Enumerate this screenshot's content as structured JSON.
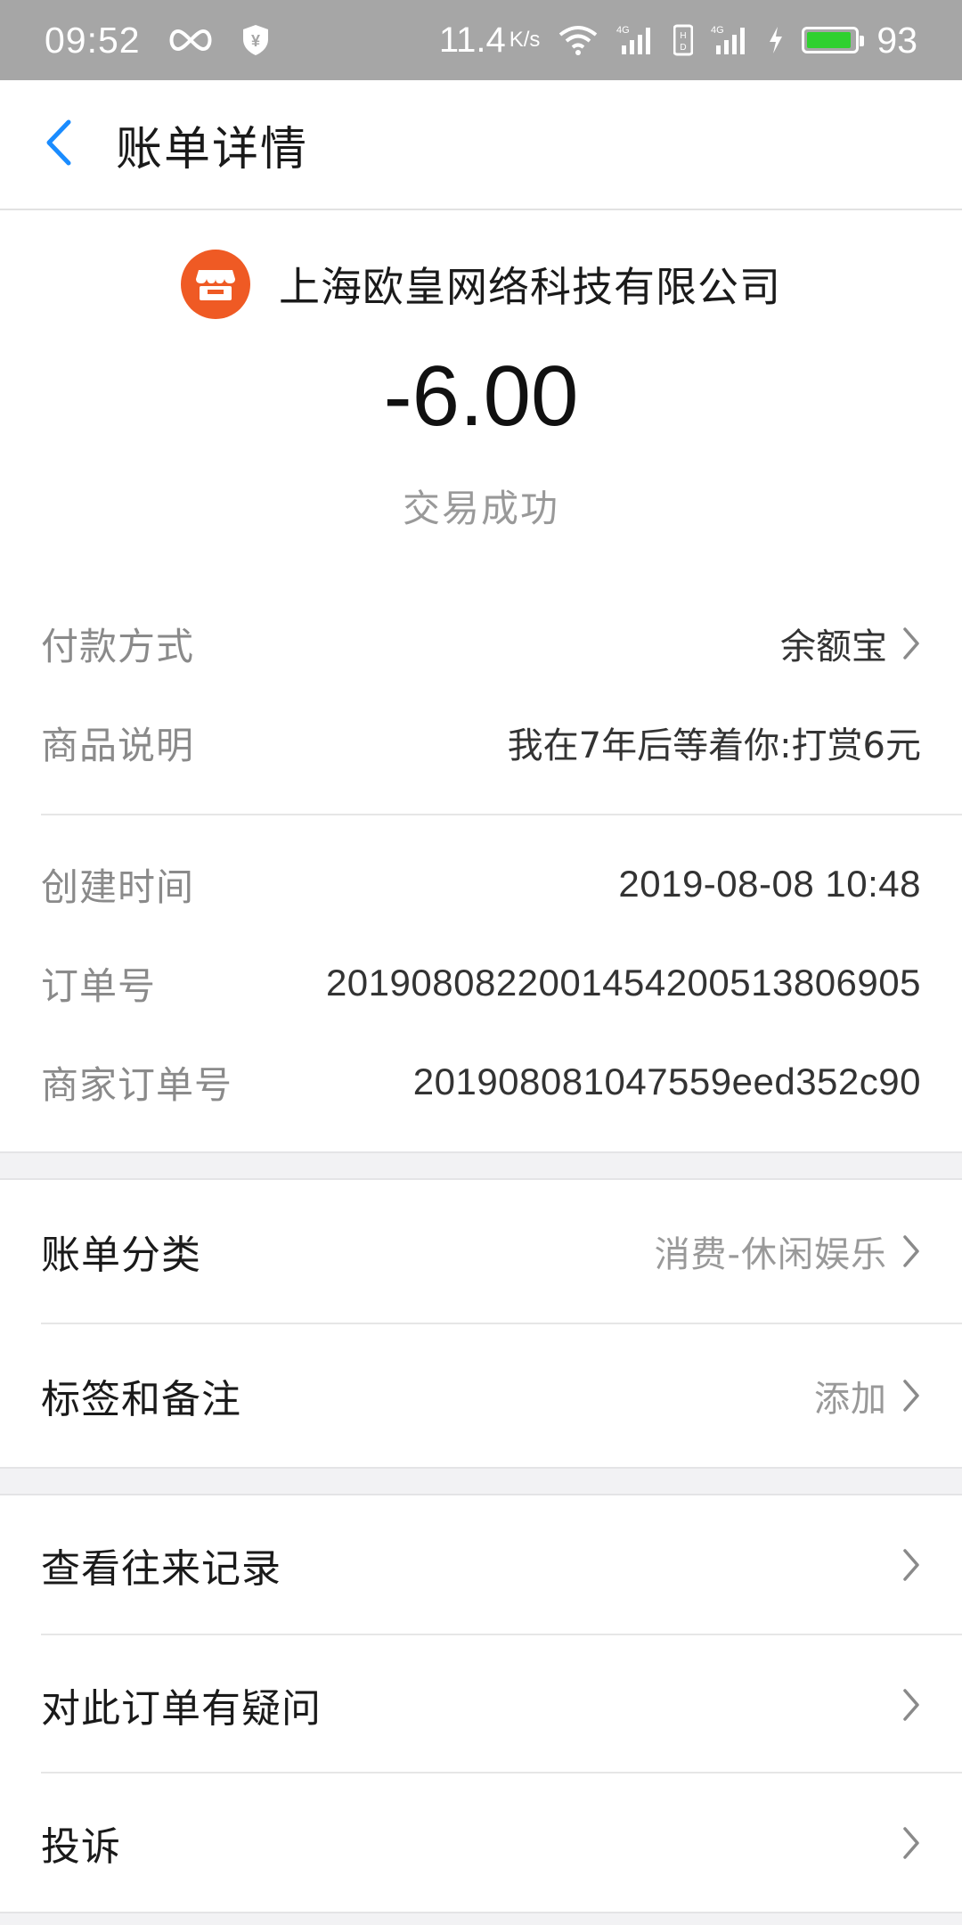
{
  "status_bar": {
    "time": "09:52",
    "net_speed": "11.4",
    "net_unit": "K/s",
    "battery_level": "93",
    "battery_fraction": 0.93,
    "battery_color": "#2fd12f",
    "icons": [
      "infinity-icon",
      "shield-yen-icon",
      "wifi-icon",
      "signal-4g-icon",
      "hd-icon",
      "signal-4g-icon",
      "charging-icon",
      "battery-icon"
    ]
  },
  "nav": {
    "title": "账单详情",
    "back_icon": "chevron-left-icon",
    "accent_color": "#1a8cff"
  },
  "header": {
    "merchant_name": "上海欧皇网络科技有限公司",
    "merchant_icon": "store-icon",
    "merchant_icon_color": "#ef5a24",
    "amount": "-6.00",
    "status": "交易成功"
  },
  "details": {
    "payment_method": {
      "label": "付款方式",
      "value": "余额宝"
    },
    "product_desc": {
      "label": "商品说明",
      "value": "我在7年后等着你:打赏6元"
    },
    "created_time": {
      "label": "创建时间",
      "value": "2019-08-08 10:48"
    },
    "order_no": {
      "label": "订单号",
      "value": "2019080822001454200513806905"
    },
    "merchant_order_no": {
      "label": "商家订单号",
      "value": "201908081047559eed352c90"
    }
  },
  "settings": {
    "category": {
      "label": "账单分类",
      "value": "消费-休闲娱乐"
    },
    "tags": {
      "label": "标签和备注",
      "value": "添加"
    }
  },
  "actions": {
    "history": {
      "label": "查看往来记录"
    },
    "question": {
      "label": "对此订单有疑问"
    },
    "complaint": {
      "label": "投诉"
    }
  }
}
